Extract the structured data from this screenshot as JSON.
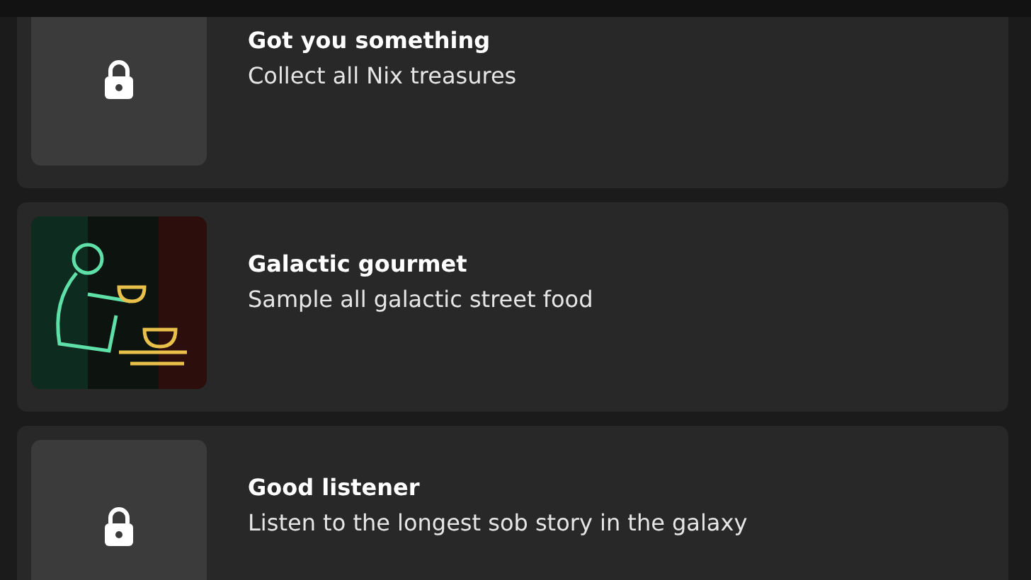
{
  "achievements": [
    {
      "title": "Got you something",
      "description": "Collect all Nix treasures",
      "unlocked": false
    },
    {
      "title": "Galactic gourmet",
      "description": "Sample all galactic street food",
      "unlocked": true,
      "kind": "picture"
    },
    {
      "title": "Good listener",
      "description": "Listen to the longest sob story in the galaxy",
      "unlocked": false
    }
  ]
}
